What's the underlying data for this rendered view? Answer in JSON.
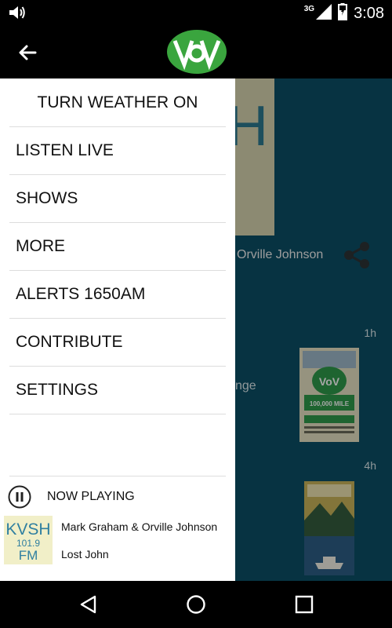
{
  "status_bar": {
    "network": "3G",
    "time": "3:08"
  },
  "app_bar": {
    "logo_text": "VoV"
  },
  "content": {
    "partial_heading": "H",
    "byline": "Orville Johnson",
    "time_1": "1h",
    "partial_text": "nge",
    "time_2": "4h",
    "thumb_1_text": "100,000 MILE CHALLENGE"
  },
  "drawer": {
    "weather_toggle": "TURN WEATHER ON",
    "items": [
      "LISTEN LIVE",
      "SHOWS",
      "MORE",
      "ALERTS 1650AM",
      "CONTRIBUTE",
      "SETTINGS"
    ],
    "now_playing_label": "NOW PLAYING",
    "station_logo": {
      "call": "KVSH",
      "freq": "101.9",
      "band": "FM"
    },
    "now_playing_title": "Mark Graham & Orville Johnson",
    "now_playing_track": "Lost John"
  },
  "colors": {
    "logo_green": "#3aa53e",
    "content_bg": "#0b4f66",
    "drawer_bg": "#ffffff",
    "station_blue": "#2f7fa0"
  },
  "icons": [
    "volume-icon",
    "signal-icon",
    "battery-icon",
    "back-arrow-icon",
    "share-icon",
    "pause-icon",
    "nav-back-icon",
    "nav-home-icon",
    "nav-recents-icon"
  ]
}
